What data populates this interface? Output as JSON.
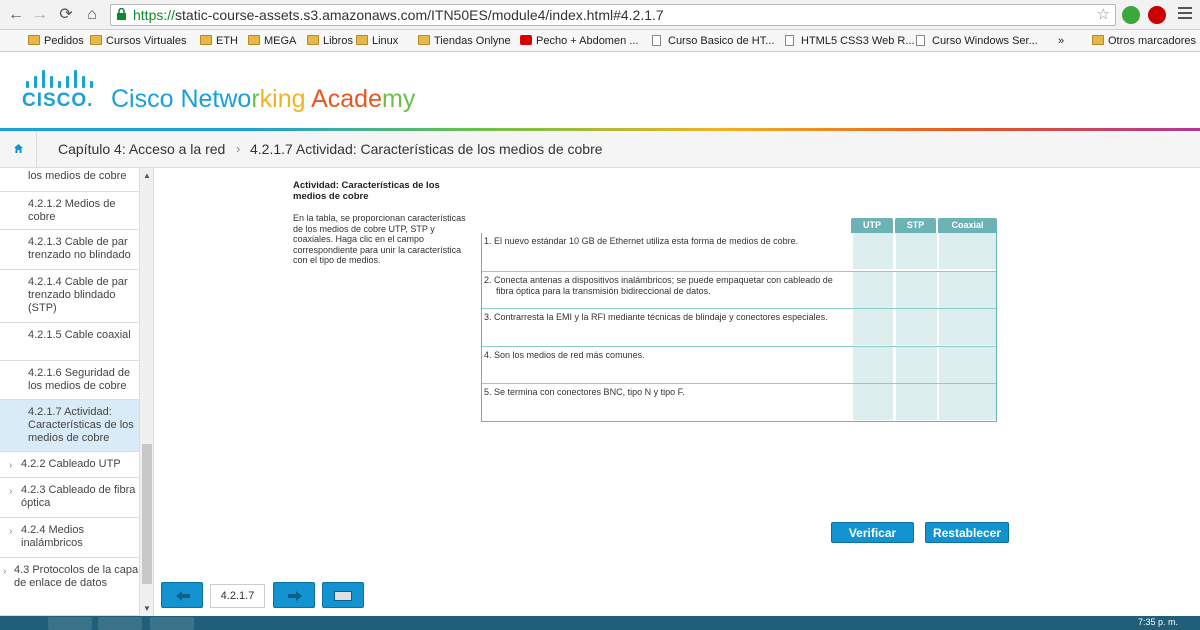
{
  "browser": {
    "url_scheme": "https://",
    "url_rest": "static-course-assets.s3.amazonaws.com/ITN50ES/module4/index.html#4.2.1.7",
    "bookmarks": [
      {
        "label": "Pedidos",
        "kind": "folder"
      },
      {
        "label": "Cursos Virtuales",
        "kind": "folder"
      },
      {
        "label": "ETH",
        "kind": "folder"
      },
      {
        "label": "MEGA",
        "kind": "folder"
      },
      {
        "label": "Libros",
        "kind": "folder"
      },
      {
        "label": "Linux",
        "kind": "folder"
      },
      {
        "label": "Tiendas Onlyne",
        "kind": "folder"
      },
      {
        "label": "Pecho + Abdomen ...",
        "kind": "youtube"
      },
      {
        "label": "Curso Basico de HT...",
        "kind": "page"
      },
      {
        "label": "HTML5 CSS3 Web R...",
        "kind": "page"
      },
      {
        "label": "Curso Windows Ser...",
        "kind": "page"
      }
    ],
    "more": "»",
    "other_bookmarks": "Otros marcadores"
  },
  "header": {
    "logo_word": "CISCO.",
    "title_parts": [
      {
        "text": "Cisco Netwo",
        "color": "#1ba0d7"
      },
      {
        "text": "r",
        "color": "#6cc04a"
      },
      {
        "text": "king ",
        "color": "#f0b323"
      },
      {
        "text": "Ac",
        "color": "#e9571f"
      },
      {
        "text": "ade",
        "color": "#e9571f"
      },
      {
        "text": "my",
        "color": "#6cc04a"
      }
    ]
  },
  "breadcrumb": {
    "chapter": "Capítulo 4: Acceso a la red",
    "separator": "›",
    "current": "4.2.1.7 Actividad: Características de los medios de cobre"
  },
  "sidebar": {
    "items": [
      {
        "label": "los medios de cobre",
        "level": "sub",
        "active": false
      },
      {
        "label": "4.2.1.2 Medios de cobre",
        "level": "sub",
        "active": false
      },
      {
        "label": "4.2.1.3 Cable de par trenzado no blindado",
        "level": "sub",
        "active": false
      },
      {
        "label": "4.2.1.4 Cable de par trenzado blindado (STP)",
        "level": "sub",
        "active": false
      },
      {
        "label": "4.2.1.5 Cable coaxial",
        "level": "sub",
        "active": false
      },
      {
        "label": "4.2.1.6 Seguridad de los medios de cobre",
        "level": "sub",
        "active": false
      },
      {
        "label": "4.2.1.7 Actividad: Características de los medios de cobre",
        "level": "sub",
        "active": true
      },
      {
        "label": "4.2.2 Cableado UTP",
        "level": "lvl2",
        "active": false
      },
      {
        "label": "4.2.3 Cableado de fibra óptica",
        "level": "lvl2",
        "active": false
      },
      {
        "label": "4.2.4 Medios inalámbricos",
        "level": "lvl2",
        "active": false
      },
      {
        "label": "4.3 Protocolos de la capa de enlace de datos",
        "level": "lvl1",
        "active": false
      }
    ]
  },
  "activity": {
    "title": "Actividad: Características de los medios de cobre",
    "description": "En la tabla, se proporcionan características de los medios de cobre UTP, STP y coaxiales. Haga clic en el campo correspondiente para unir la característica con el tipo de medios.",
    "columns": [
      "UTP",
      "STP",
      "Coaxial"
    ],
    "rows": [
      "1. El nuevo estándar 10 GB de Ethernet utiliza esta forma de medios de cobre.",
      "2. Conecta antenas a dispositivos inalámbricos; se puede empaquetar con cableado de fibra óptica para la transmisión bidireccional de datos.",
      "3. Contrarresta la EMI y la RFI mediante técnicas de blindaje y conectores especiales.",
      "4. Son los medios de red más comunes.",
      "5. Se termina con conectores BNC, tipo N y tipo F."
    ],
    "verify_label": "Verificar",
    "reset_label": "Restablecer"
  },
  "pager": {
    "page_number": "4.2.1.7"
  },
  "taskbar": {
    "clock": "7:35 p. m."
  }
}
